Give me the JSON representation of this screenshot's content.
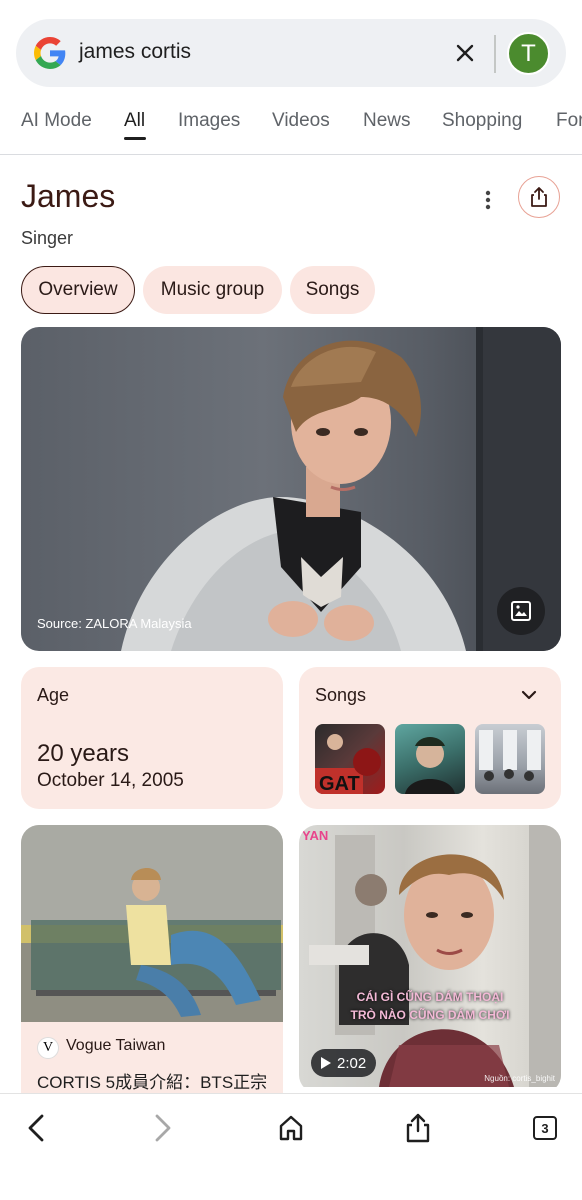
{
  "search": {
    "query": "james cortis",
    "avatar_letter": "T"
  },
  "tabs": [
    {
      "label": "AI Mode"
    },
    {
      "label": "All"
    },
    {
      "label": "Images"
    },
    {
      "label": "Videos"
    },
    {
      "label": "News"
    },
    {
      "label": "Shopping"
    },
    {
      "label": "For"
    }
  ],
  "active_tab": "All",
  "entity": {
    "title": "James",
    "subtitle": "Singer"
  },
  "chips": [
    {
      "label": "Overview",
      "active": true
    },
    {
      "label": "Music group",
      "active": false
    },
    {
      "label": "Songs",
      "active": false
    }
  ],
  "hero": {
    "source": "Source: ZALORA Malaysia"
  },
  "age_card": {
    "label": "Age",
    "years": "20 years",
    "date": "October 14, 2005"
  },
  "songs_card": {
    "label": "Songs"
  },
  "results": [
    {
      "publisher": "Vogue Taiwan",
      "publisher_logo": "V",
      "title": "CORTIS 5成員介紹：BTS正宗"
    },
    {
      "brand": "YAN",
      "caption_line1": "CÁI GÌ CŨNG DÁM THOẠI",
      "caption_line2": "TRÒ NÀO CŨNG DÁM CHƠI",
      "duration": "2:02",
      "credit": "Nguồn: cortis_bighit"
    }
  ],
  "bottom_nav": {
    "tab_count": "3"
  },
  "colors": {
    "accent_chip": "#fbe6e1",
    "card_bg": "#fbe9e4",
    "title_color": "#3b1a14",
    "avatar": "#4b8b2e"
  }
}
